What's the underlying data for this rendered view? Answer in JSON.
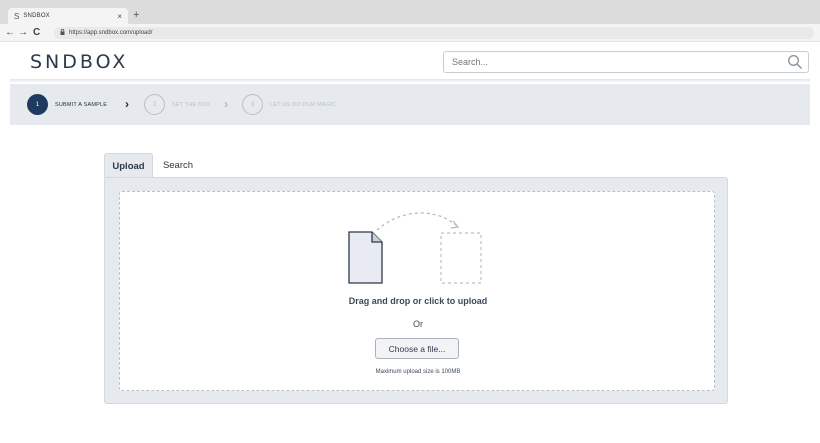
{
  "browser": {
    "tab_title": "SNDBOX",
    "tab_favicon": "S",
    "tab_close": "×",
    "new_tab": "+",
    "url": "https://app.sndbox.com/upload/",
    "back": "←",
    "forward": "→",
    "reload": "C"
  },
  "header": {
    "logo": "SNDBOX",
    "search_placeholder": "Search..."
  },
  "steps": [
    {
      "number": "1",
      "label": "SUBMIT A SAMPLE",
      "active": true
    },
    {
      "number": "2",
      "label": "SET THE BOX",
      "active": false
    },
    {
      "number": "3",
      "label": "LET US DO OUR MAGIC",
      "active": false
    }
  ],
  "step_separator": "›",
  "panel": {
    "tabs": [
      {
        "label": "Upload",
        "active": true
      },
      {
        "label": "Search",
        "active": false
      }
    ],
    "drop_text": "Drag and drop or click to upload",
    "or_text": "Or",
    "choose_button": "Choose a file...",
    "max_size_text": "Maximum upload size is 100MB"
  },
  "colors": {
    "accent_dark": "#1e3a5f",
    "panel_bg": "#e6e9ee",
    "muted": "#b8bfc9"
  },
  "icons": [
    "file-icon",
    "dashed-target-icon",
    "search-icon",
    "lock-icon",
    "chevron-right-icon"
  ]
}
